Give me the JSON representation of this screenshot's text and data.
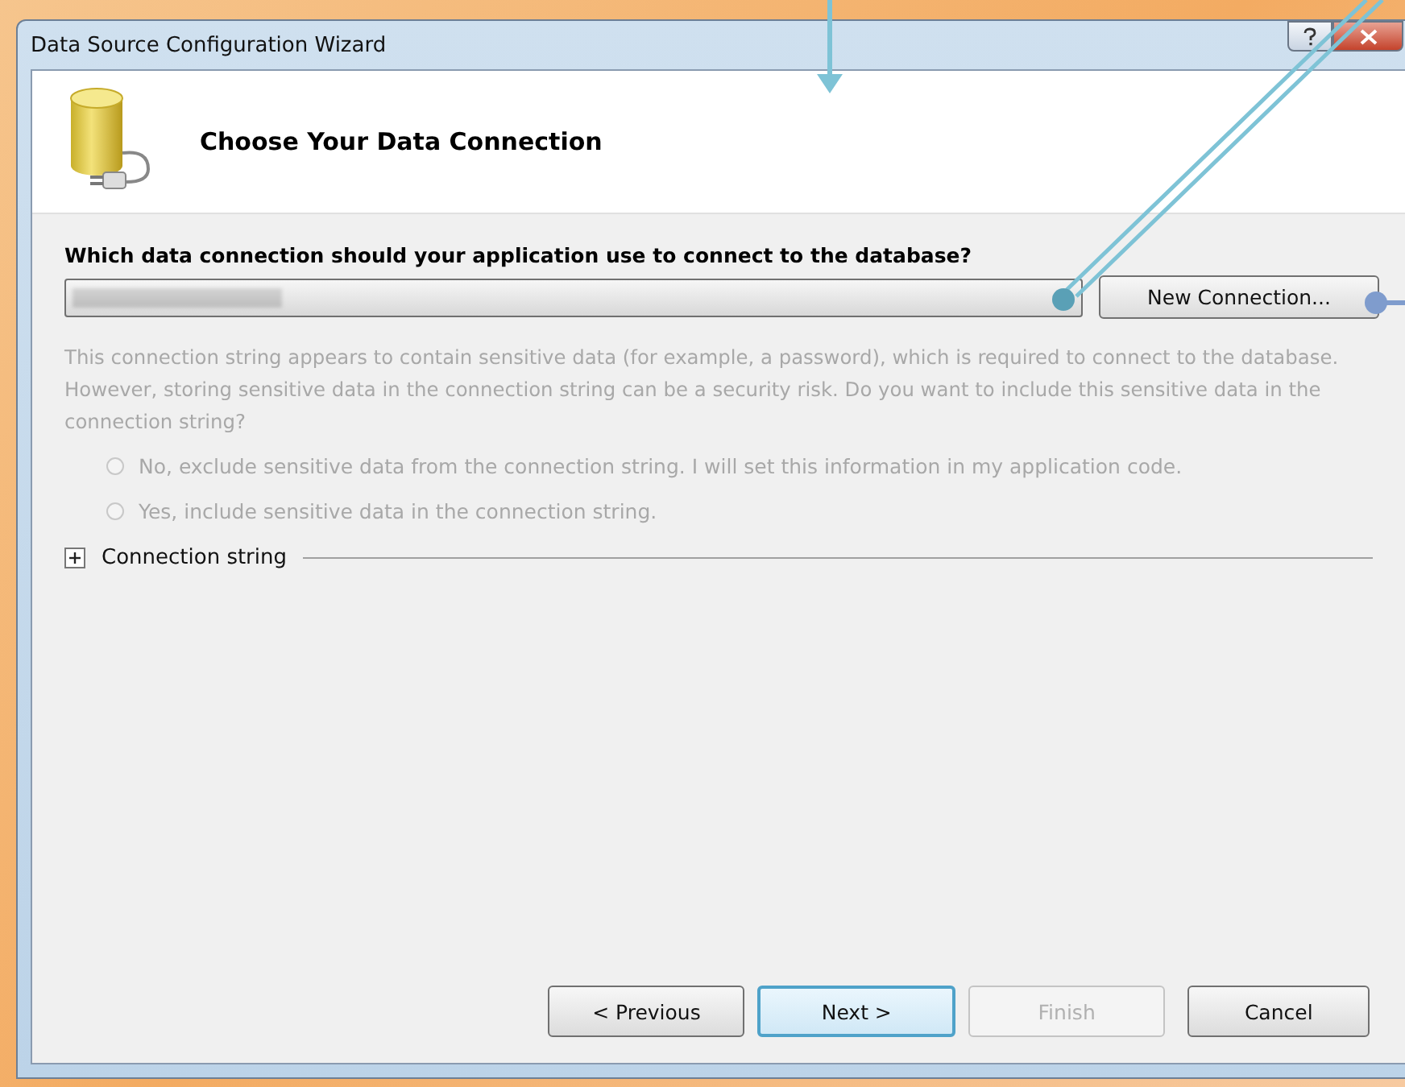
{
  "window": {
    "title": "Data Source Configuration Wizard"
  },
  "header": {
    "title": "Choose Your Data Connection"
  },
  "question": "Which data connection should your application use to connect to the database?",
  "new_connection_button": "New Connection...",
  "sensitive_note": {
    "text": "This connection string appears to contain sensitive data (for example, a password), which is required to connect to the database. However, storing sensitive data in the connection string can be a security risk. Do you want to include this sensitive data in the connection string?",
    "disabled": true
  },
  "radios": [
    {
      "label": "No, exclude sensitive data from the connection string. I will set this information in my application code.",
      "selected": false,
      "disabled": true
    },
    {
      "label": "Yes, include sensitive data in the connection string.",
      "selected": false,
      "disabled": true
    }
  ],
  "connection_string": {
    "label": "Connection string",
    "expanded": false
  },
  "buttons": [
    {
      "label": "< Previous",
      "disabled": false,
      "default": false
    },
    {
      "label": "Next >",
      "disabled": false,
      "default": true
    },
    {
      "label": "Finish",
      "disabled": true,
      "default": false
    },
    {
      "label": "Cancel",
      "disabled": false,
      "default": false
    }
  ]
}
